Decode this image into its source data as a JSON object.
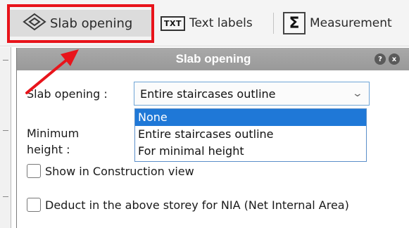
{
  "toolbar": {
    "slab_opening_label": "Slab opening",
    "text_labels_icon_text": "TXT",
    "text_labels_label": "Text labels",
    "measurements_icon_text": "Σ",
    "measurements_label": "Measurement"
  },
  "panel": {
    "title": "Slab opening",
    "help_glyph": "?",
    "close_glyph": "x",
    "slab_opening_label": "Slab opening :",
    "select_value": "Entire staircases outline",
    "dropdown_options": [
      "None",
      "Entire staircases outline",
      "For minimal height"
    ],
    "minimum_height_label_line1": "Minimum",
    "minimum_height_label_line2": "height :",
    "show_construction_label": "Show in Construction view",
    "deduct_label": "Deduct in the above storey for NIA (Net Internal Area)"
  },
  "annotation": {
    "highlight_color": "#e8141b"
  },
  "icons": [
    "slab-opening-icon",
    "txt-icon",
    "sigma-icon",
    "chevron-down-icon",
    "help-icon",
    "close-icon",
    "annotation-arrow"
  ]
}
